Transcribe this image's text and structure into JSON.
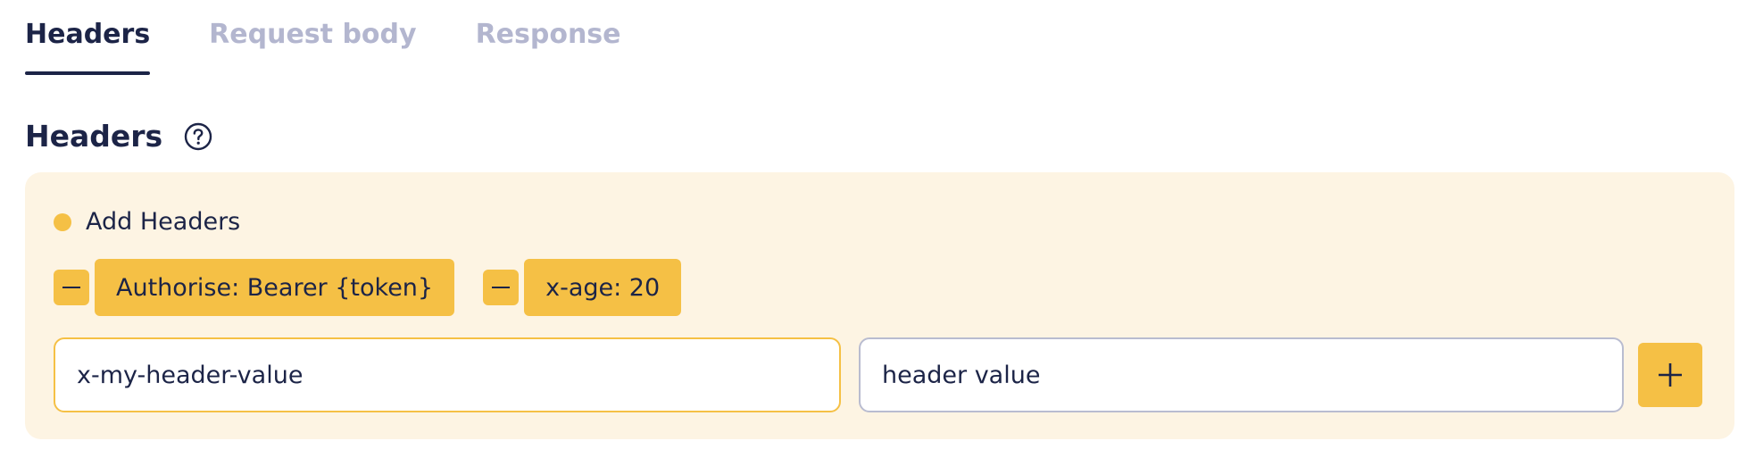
{
  "tabs": [
    {
      "label": "Headers",
      "active": true
    },
    {
      "label": "Request body",
      "active": false
    },
    {
      "label": "Response",
      "active": false
    }
  ],
  "section": {
    "title": "Headers",
    "help_icon": "question-circle-icon"
  },
  "panel": {
    "label": "Add Headers",
    "headers": [
      {
        "text": "Authorise: Bearer {token}"
      },
      {
        "text": "x-age: 20"
      }
    ],
    "key_input": {
      "value": "x-my-header-value",
      "placeholder": ""
    },
    "value_input": {
      "value": "header value",
      "placeholder": ""
    },
    "add_icon": "plus-icon",
    "remove_icon": "minus-icon"
  },
  "colors": {
    "accent": "#f5c045",
    "panel_bg": "#fdf4e3",
    "text": "#1c2447",
    "muted": "#b3b6cf"
  }
}
